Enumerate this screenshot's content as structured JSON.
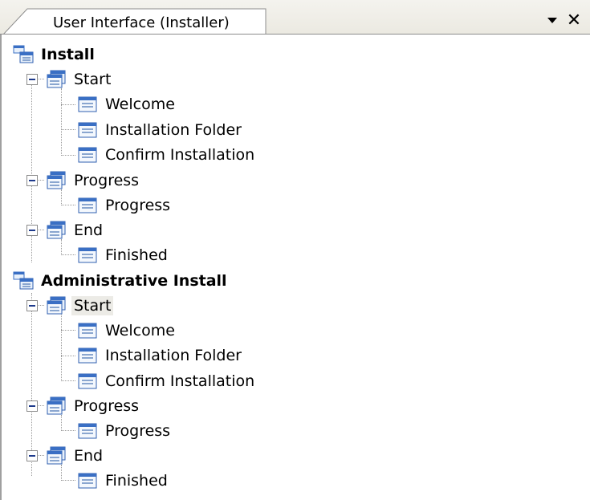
{
  "tab": {
    "title": "User Interface (Installer)"
  },
  "controls": {
    "dropdown_glyph": "▾",
    "close_glyph": "✕"
  },
  "tree": {
    "install": {
      "label": "Install",
      "start": {
        "label": "Start",
        "children": [
          "Welcome",
          "Installation Folder",
          "Confirm Installation"
        ]
      },
      "progress": {
        "label": "Progress",
        "children": [
          "Progress"
        ]
      },
      "end": {
        "label": "End",
        "children": [
          "Finished"
        ]
      }
    },
    "admin": {
      "label": "Administrative Install",
      "start": {
        "label": "Start",
        "children": [
          "Welcome",
          "Installation Folder",
          "Confirm Installation"
        ]
      },
      "progress": {
        "label": "Progress",
        "children": [
          "Progress"
        ]
      },
      "end": {
        "label": "End",
        "children": [
          "Finished"
        ]
      }
    },
    "selected": "Administrative Install / Start"
  },
  "icons": {
    "root": "installer-root-icon",
    "group": "dialog-group-icon",
    "dialog": "dialog-icon"
  },
  "colors": {
    "icon_blue": "#3a6fc4",
    "selection": "#ecebe6",
    "tree_lines": "#9a9a9a"
  }
}
